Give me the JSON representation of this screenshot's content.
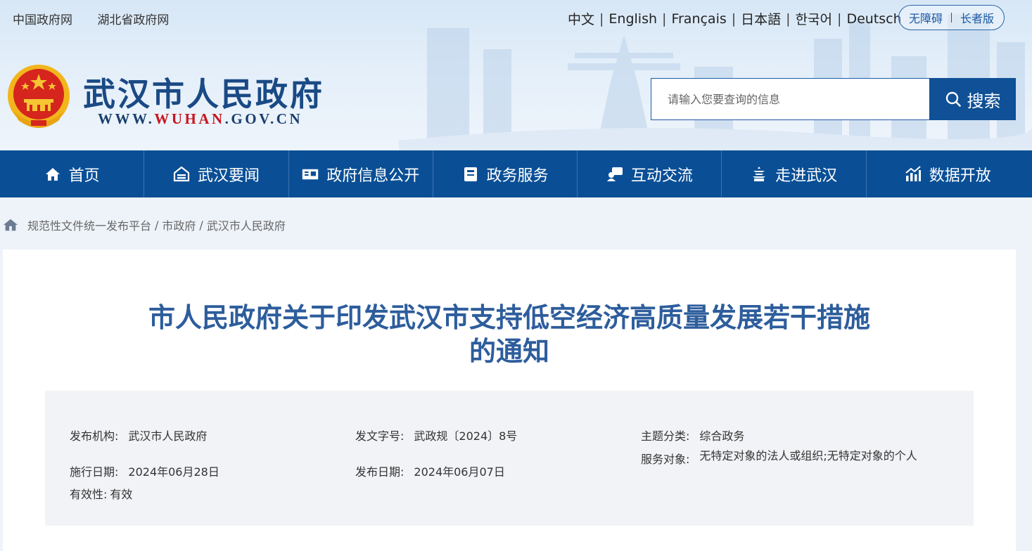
{
  "top": {
    "links": [
      "中国政府网",
      "湖北省政府网"
    ],
    "languages": [
      "中文",
      "English",
      "Français",
      "日本語",
      "한국어",
      "Deutsch"
    ],
    "accessibility": "无障碍",
    "elder": "长者版"
  },
  "site": {
    "title": "武汉市人民政府",
    "url_prefix": "WWW.",
    "url_highlight": "WUHAN",
    "url_suffix": ".GOV.CN"
  },
  "search": {
    "placeholder": "请输入您要查询的信息",
    "button": "搜索"
  },
  "nav": [
    {
      "label": "首页",
      "icon": "home-icon"
    },
    {
      "label": "武汉要闻",
      "icon": "news-icon"
    },
    {
      "label": "政府信息公开",
      "icon": "info-icon"
    },
    {
      "label": "政务服务",
      "icon": "service-icon"
    },
    {
      "label": "互动交流",
      "icon": "chat-icon"
    },
    {
      "label": "走进武汉",
      "icon": "tower-icon"
    },
    {
      "label": "数据开放",
      "icon": "chart-icon"
    }
  ],
  "breadcrumb": [
    "规范性文件统一发布平台",
    "市政府",
    "武汉市人民政府"
  ],
  "document": {
    "title_line1": "市人民政府关于印发武汉市支持低空经济高质量发展若干措施",
    "title_line2": "的通知",
    "meta": {
      "issuer_label": "发布机构:",
      "issuer": "武汉市人民政府",
      "doc_no_label": "发文字号:",
      "doc_no": "武政规〔2024〕8号",
      "topic_label": "主题分类:",
      "topic": "综合政务",
      "effective_date_label": "施行日期:",
      "effective_date": "2024年06月28日",
      "publish_date_label": "发布日期:",
      "publish_date": "2024年06月07日",
      "audience_label": "服务对象:",
      "audience": "无特定对象的法人或组织;无特定对象的个人",
      "validity_label": "有效性:",
      "validity": "有效"
    }
  },
  "colors": {
    "nav_bg": "#0a4f96",
    "title_blue": "#2d5d9c",
    "accent_red": "#c8161d"
  }
}
